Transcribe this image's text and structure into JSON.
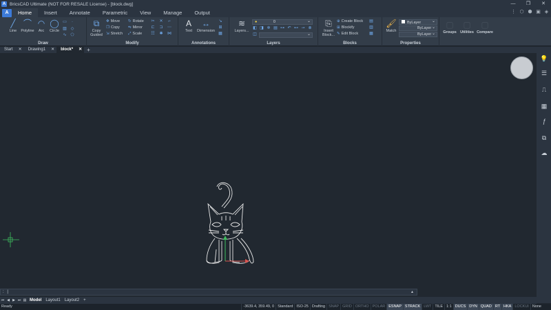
{
  "window": {
    "title": "BricsCAD Ultimate (NOT FOR RESALE License) - [block.dwg]",
    "controls": [
      "—",
      "❐",
      "✕"
    ]
  },
  "ribbon_tabs": [
    {
      "label": "Home",
      "active": true
    },
    {
      "label": "Insert",
      "active": false
    },
    {
      "label": "Annotate",
      "active": false
    },
    {
      "label": "Parametric",
      "active": false
    },
    {
      "label": "View",
      "active": false
    },
    {
      "label": "Manage",
      "active": false
    },
    {
      "label": "Output",
      "active": false
    }
  ],
  "panels": {
    "draw": {
      "title": "Draw",
      "tools": [
        "Line",
        "Polyline",
        "Arc",
        "Circle"
      ]
    },
    "modify": {
      "title": "Modify",
      "copy": "Copy",
      "guided": "Guided",
      "col1": [
        "Move",
        "Copy",
        "Stretch"
      ],
      "col2": [
        "Rotate",
        "Mirror",
        "Scale"
      ]
    },
    "annotations": {
      "title": "Annotations",
      "tools": [
        "Text",
        "Dimension"
      ]
    },
    "layers": {
      "title": "Layers",
      "button": "Layers...",
      "current_layer": "0"
    },
    "blocks": {
      "title": "Blocks",
      "insert": "Insert",
      "insert2": "Block...",
      "items": [
        "Create Block",
        "Blockify",
        "Edit Block"
      ]
    },
    "properties": {
      "title": "Properties",
      "match": "Match",
      "combos": [
        "ByLayer",
        "ByLayer",
        "ByLayer"
      ]
    },
    "groups": {
      "label": "Groups"
    },
    "utilities": {
      "label": "Utilities"
    },
    "compare": {
      "label": "Compare"
    }
  },
  "doc_tabs": [
    {
      "label": "Start",
      "active": false
    },
    {
      "label": "Drawing1",
      "active": false
    },
    {
      "label": "block*",
      "active": true
    }
  ],
  "command_line": {
    "prompt": ":"
  },
  "layout_tabs": [
    {
      "label": "Model",
      "active": true
    },
    {
      "label": "Layout1",
      "active": false
    },
    {
      "label": "Layout2",
      "active": false
    }
  ],
  "status": {
    "ready": "Ready",
    "coords": "-3639.4, 359.49, 0",
    "items": [
      {
        "label": "Standard",
        "state": "plain"
      },
      {
        "label": "ISO-25",
        "state": "plain"
      },
      {
        "label": "Drafting",
        "state": "plain"
      },
      {
        "label": "SNAP",
        "state": "off"
      },
      {
        "label": "GRID",
        "state": "off"
      },
      {
        "label": "ORTHO",
        "state": "off"
      },
      {
        "label": "POLAR",
        "state": "off"
      },
      {
        "label": "ESNAP",
        "state": "on"
      },
      {
        "label": "STRACK",
        "state": "on"
      },
      {
        "label": "LWT",
        "state": "off"
      },
      {
        "label": "TILE",
        "state": "plain"
      },
      {
        "label": "1:1",
        "state": "plain"
      },
      {
        "label": "DUCS",
        "state": "on"
      },
      {
        "label": "DYN",
        "state": "on"
      },
      {
        "label": "QUAD",
        "state": "on"
      },
      {
        "label": "RT",
        "state": "on"
      },
      {
        "label": "HKA",
        "state": "on"
      },
      {
        "label": "LOCKUI",
        "state": "off"
      },
      {
        "label": "None",
        "state": "plain"
      }
    ]
  },
  "colors": {
    "accent": "#3d7bd9",
    "x_axis": "#d9534f",
    "y_axis": "#3fbf5f",
    "drawing": "#e8e8e8"
  }
}
